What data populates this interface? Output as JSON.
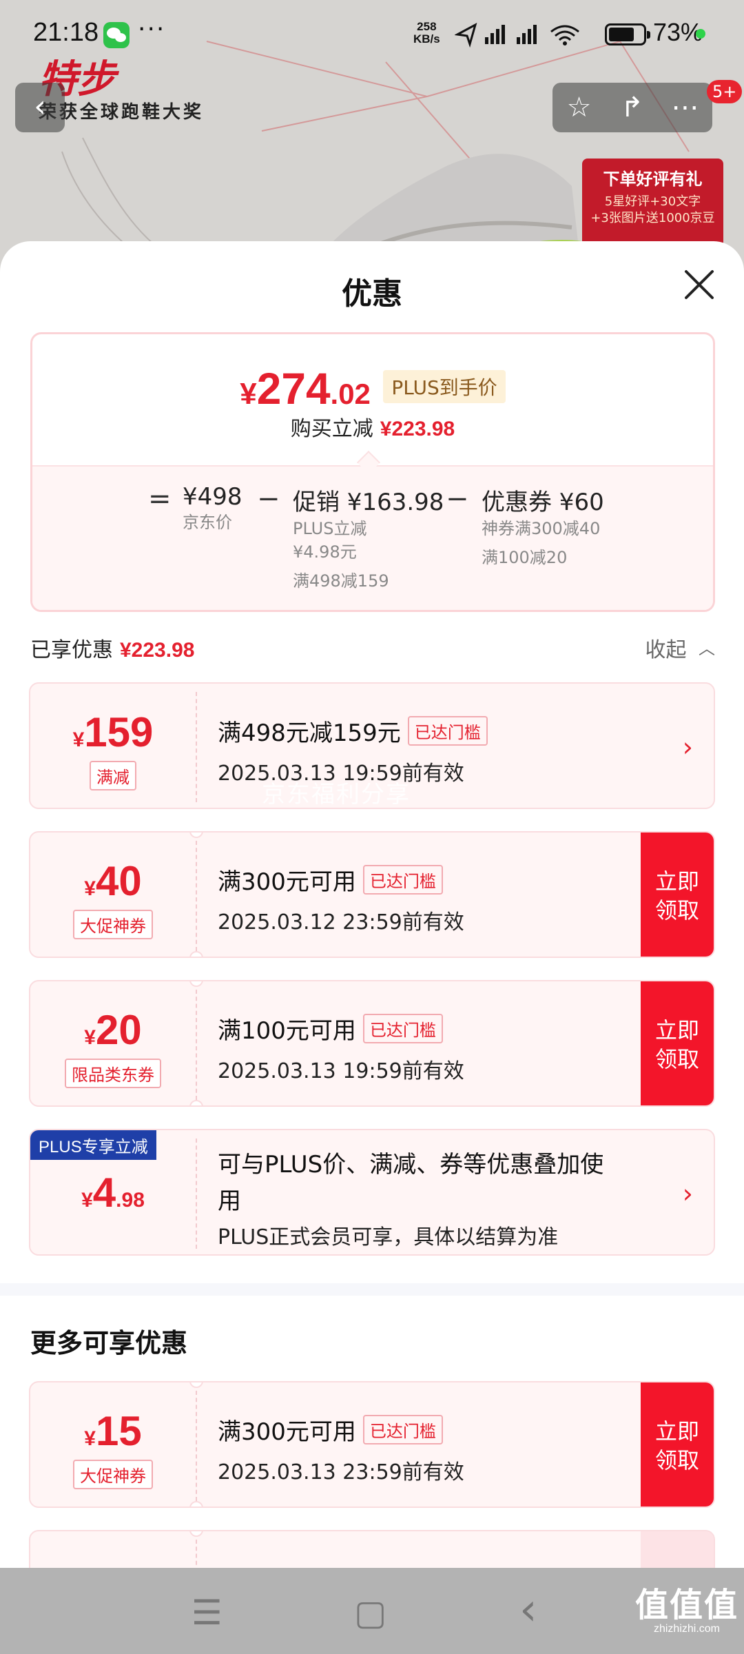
{
  "status_bar": {
    "time": "21:18",
    "more": "···",
    "speed_value": "258",
    "speed_unit": "KB/s",
    "battery": "73%"
  },
  "background": {
    "brand_logo": "特步",
    "brand_slogan": "荣获全球跑鞋大奖",
    "cart_badge": "5+",
    "promo_title": "下单好评有礼",
    "promo_line1": "5星好评+30文字",
    "promo_line2": "+3张图片送1000京豆"
  },
  "sheet": {
    "title": "优惠",
    "summary": {
      "price_yen": "¥",
      "price_int": "274",
      "price_dec": ".02",
      "plus_tag": "PLUS到手价",
      "save_label": "购买立减",
      "save_amount": "¥223.98",
      "equals": "=",
      "jd_price": "¥498",
      "jd_price_label": "京东价",
      "minus1": "−",
      "promo": "促销 ¥163.98",
      "promo_detail1": "PLUS立减",
      "promo_detail2": "¥4.98元",
      "promo_detail3": "满498减159",
      "minus2": "−",
      "coupon": "优惠券 ¥60",
      "coupon_detail1": "神券满300减40",
      "coupon_detail2": "满100减20"
    },
    "enjoyed_label": "已享优惠",
    "enjoyed_amount": "¥223.98",
    "collapse_label": "收起",
    "coupons": [
      {
        "yen": "¥",
        "amount": "159",
        "tag": "满减",
        "title": "满498元减159元",
        "status": "已达门槛",
        "valid": "2025.03.13 19:59前有效"
      },
      {
        "yen": "¥",
        "amount": "40",
        "tag": "大促神券",
        "title": "满300元可用",
        "status": "已达门槛",
        "valid": "2025.03.12 23:59前有效",
        "claim": "立即\n领取"
      },
      {
        "yen": "¥",
        "amount": "20",
        "tag": "限品类东券",
        "title": "满100元可用",
        "status": "已达门槛",
        "valid": "2025.03.13 19:59前有效",
        "claim": "立即\n领取"
      }
    ],
    "plus_offer": {
      "badge": "PLUS专享立减",
      "yen": "¥",
      "amount_int": "4",
      "amount_dec": ".98",
      "line1": "可与PLUS价、满减、券等优惠叠加使",
      "line2": "用",
      "line3": "PLUS正式会员可享，具体以结算为准"
    },
    "watermark": "京东福利分享",
    "more_title": "更多可享优惠",
    "more_coupons": [
      {
        "yen": "¥",
        "amount": "15",
        "tag": "大促神券",
        "title": "满300元可用",
        "status": "已达门槛",
        "valid": "2025.03.13 23:59前有效",
        "claim": "立即\n领取"
      }
    ]
  },
  "nav": {
    "menu_icon": "☰",
    "home_icon": "▢",
    "back_icon": "‹",
    "site_logo": "值值值",
    "site_url": "zhizhizhi.com"
  }
}
